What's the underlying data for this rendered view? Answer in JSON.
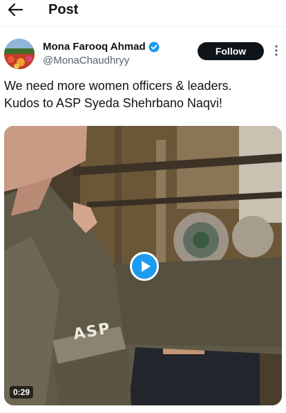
{
  "header": {
    "title": "Post",
    "back_icon": "arrow-left-icon"
  },
  "author": {
    "name": "Mona Farooq Ahmad",
    "handle": "@MonaChaudhryy",
    "verified": true,
    "verified_color": "#1d9bf0",
    "follow_label": "Follow"
  },
  "tweet": {
    "line1": "We need more women officers & leaders.",
    "line2": "Kudos to ASP Syeda Shehrbano Naqvi!"
  },
  "video": {
    "duration": "0:29",
    "uniform_badge": "ASP",
    "play_color": "#1d9bf0"
  }
}
